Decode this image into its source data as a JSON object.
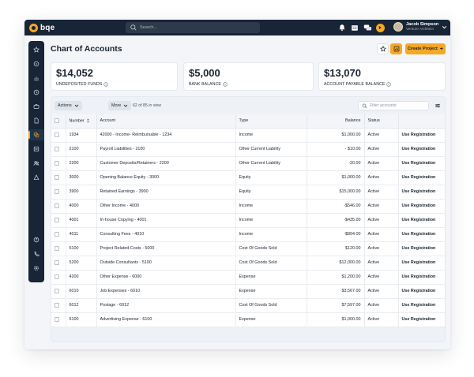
{
  "app": {
    "logo_text": "bqe",
    "search_placeholder": "Search...",
    "user": {
      "name": "Jacob Simpson",
      "role": "Venture Architect"
    }
  },
  "sidebar": {
    "items": [
      {
        "icon": "star-icon"
      },
      {
        "icon": "home-icon"
      },
      {
        "icon": "chart-icon"
      },
      {
        "icon": "clock-icon"
      },
      {
        "icon": "briefcase-icon"
      },
      {
        "icon": "document-icon"
      },
      {
        "icon": "coins-icon",
        "active": true
      },
      {
        "icon": "ledger-icon"
      },
      {
        "icon": "users-icon"
      },
      {
        "icon": "hierarchy-icon"
      },
      {
        "icon": "help-icon"
      },
      {
        "icon": "phone-icon"
      },
      {
        "icon": "settings-icon"
      }
    ]
  },
  "header": {
    "title": "Chart of Accounts",
    "create_label": "Create Project",
    "create_plus": "+"
  },
  "kpis": [
    {
      "value": "$14,052",
      "label": "UNDEPOSITED FUNDS"
    },
    {
      "value": "$5,000",
      "label": "BANK BALANCE"
    },
    {
      "value": "$13,070",
      "label": "ACCOUNT PAYABLE BALANCE"
    }
  ],
  "toolbar": {
    "actions_label": "Actions",
    "more_label": "More",
    "count_text": "62 of 85 in view",
    "filter_placeholder": "Filter accounts"
  },
  "table": {
    "columns": [
      "Number",
      "Account",
      "Type",
      "Balance",
      "Status",
      ""
    ],
    "rows": [
      {
        "number": "1934",
        "account": "42000 - Income- Reimbursable - 1234",
        "type": "Income",
        "balance": "$1,000.00",
        "status": "Active",
        "action": "Use Registration"
      },
      {
        "number": "2100",
        "account": "Payroll Liabilities - 2100",
        "type": "Other Current Liability",
        "balance": "- $10.00",
        "status": "Active",
        "action": "Use Registration"
      },
      {
        "number": "2200",
        "account": "Customer Deposits/Retainers - 2200",
        "type": "Other Current Liability",
        "balance": "-20.00",
        "status": "Active",
        "action": "Use Registration"
      },
      {
        "number": "3000",
        "account": "Opening Balance Equity - 3000",
        "type": "Equity",
        "balance": "$1,000.00",
        "status": "Active",
        "action": "Use Registration"
      },
      {
        "number": "3900",
        "account": "Retained Earnings - 3900",
        "type": "Equity",
        "balance": "$15,000.00",
        "status": "Active",
        "action": "Use Registration"
      },
      {
        "number": "4000",
        "account": "Other Income - 4000",
        "type": "Income",
        "balance": "-$546.00",
        "status": "Active",
        "action": "Use Registration"
      },
      {
        "number": "4001",
        "account": "In-house Copying - 4001",
        "type": "Income",
        "balance": "-$435.00",
        "status": "Active",
        "action": "Use Registration"
      },
      {
        "number": "4011",
        "account": "Consulting Fees - 4010",
        "type": "Income",
        "balance": "-$894.00",
        "status": "Active",
        "action": "Use Registration"
      },
      {
        "number": "5100",
        "account": "Project Related Costs - 5000",
        "type": "Cost Of Goods Sold",
        "balance": "$120.00",
        "status": "Active",
        "action": "Use Registration"
      },
      {
        "number": "5200",
        "account": "Outside Consultants - 5100",
        "type": "Cost Of Goods Sold",
        "balance": "$12,000.00",
        "status": "Active",
        "action": "Use Registration"
      },
      {
        "number": "4200",
        "account": "Other Expense - 6000",
        "type": "Expense",
        "balance": "$1,200.00",
        "status": "Active",
        "action": "Use Registration"
      },
      {
        "number": "6010",
        "account": "Job Expenses - 6010",
        "type": "Expense",
        "balance": "$3,567.00",
        "status": "Active",
        "action": "Use Registration"
      },
      {
        "number": "6012",
        "account": "Postage - 6012",
        "type": "Cost Of Goods Sold",
        "balance": "$7,597.00",
        "status": "Active",
        "action": "Use Registration"
      },
      {
        "number": "6100",
        "account": "Advertising Expense - 6100",
        "type": "Expense",
        "balance": "$1,000.00",
        "status": "Active",
        "action": "Use Registration"
      }
    ]
  },
  "colors": {
    "accent": "#f7a823",
    "navy": "#172536"
  }
}
